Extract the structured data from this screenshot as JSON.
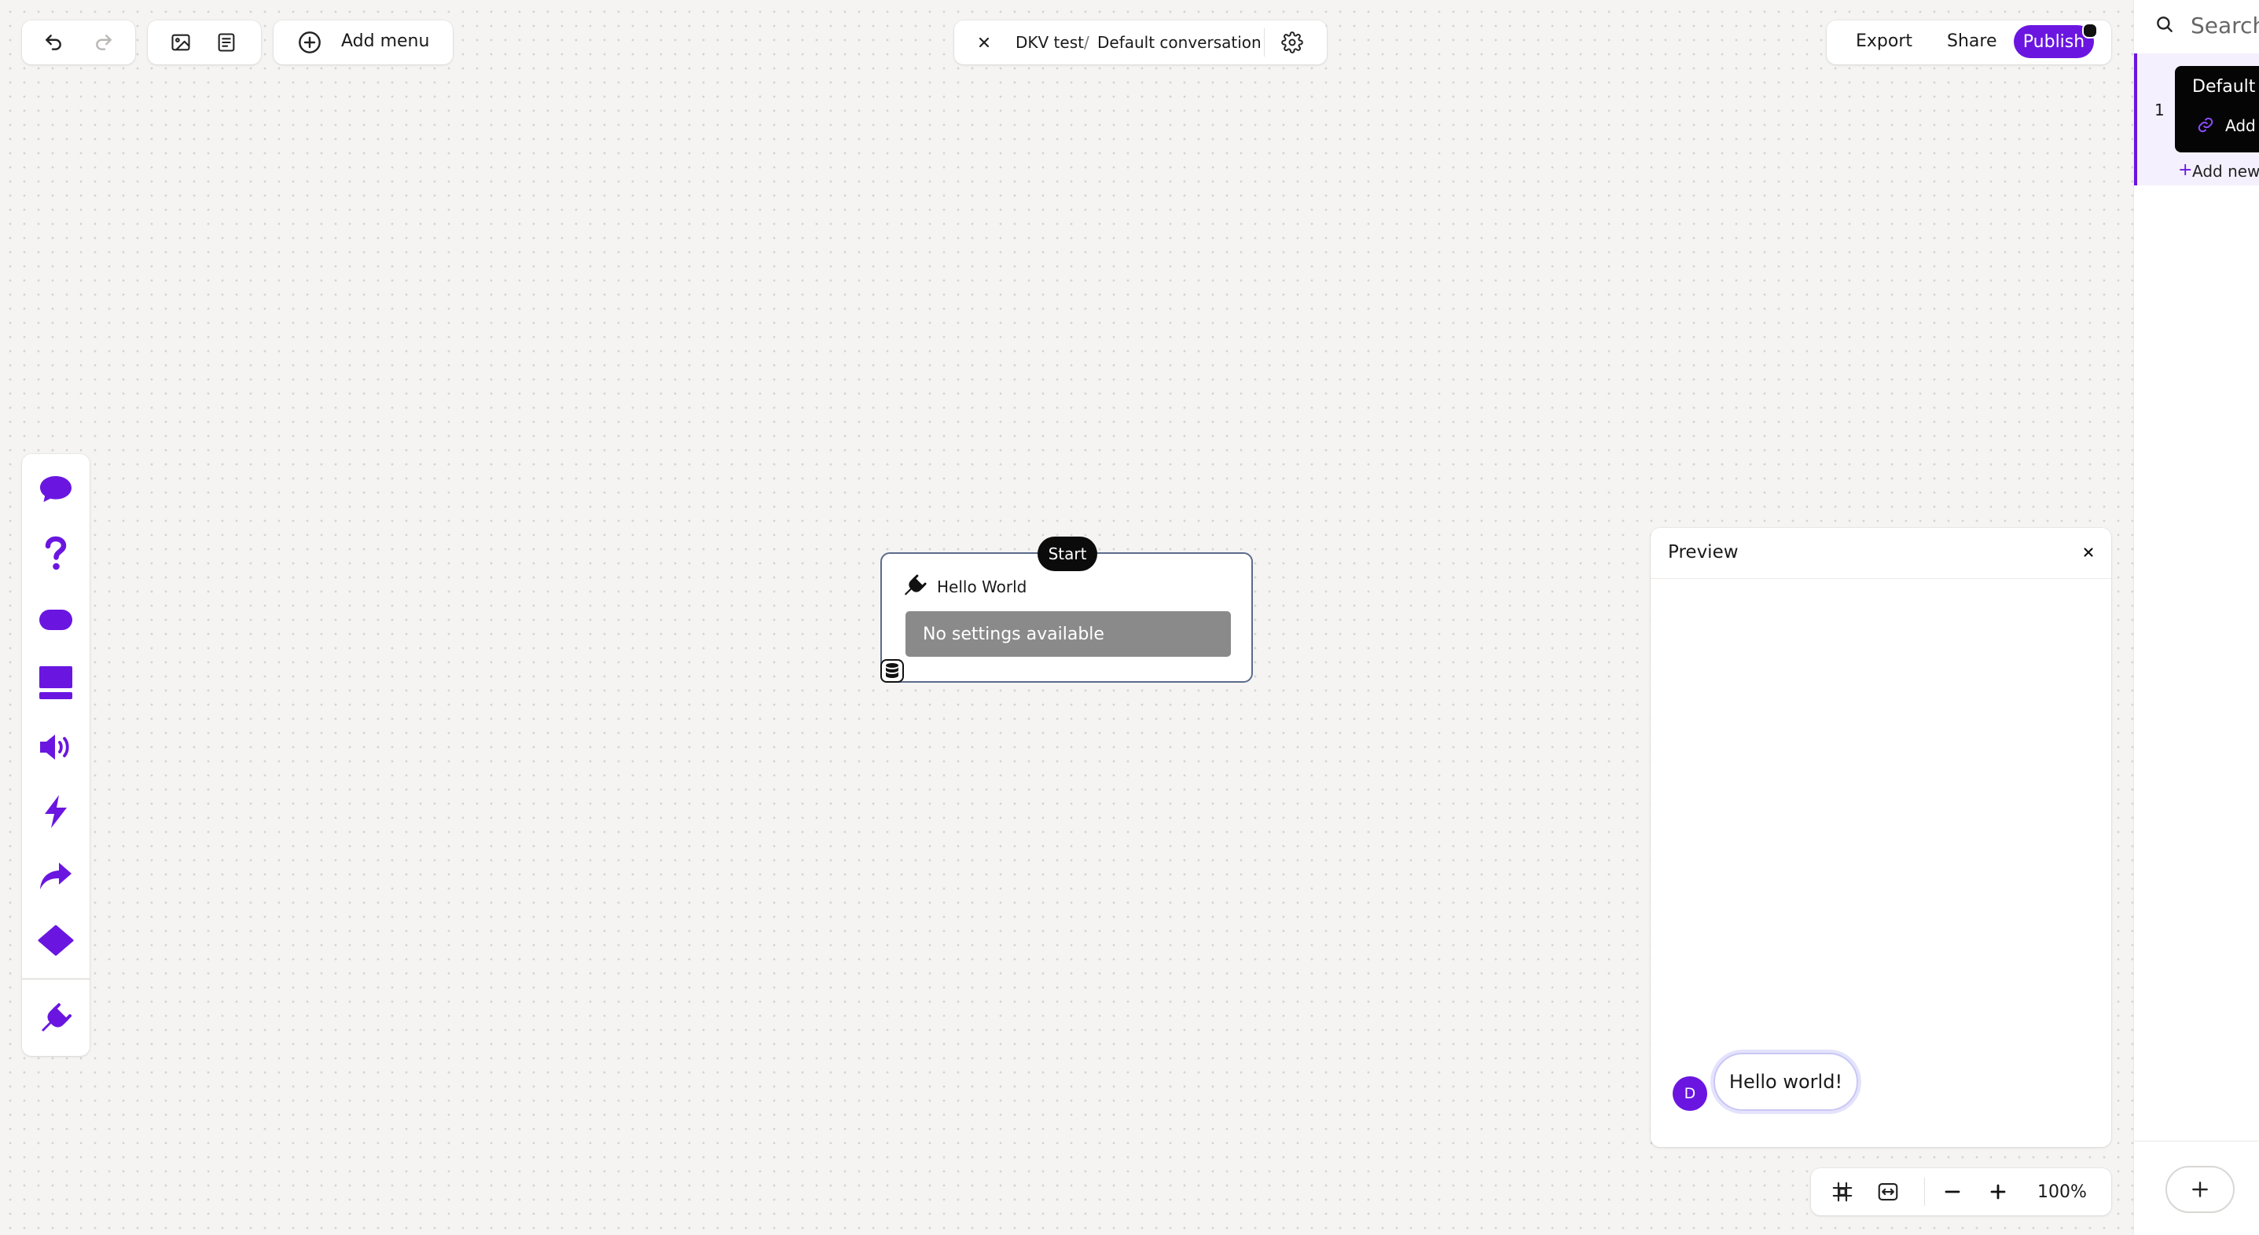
{
  "toolbar": {
    "undo_icon": "undo-icon",
    "redo_icon": "redo-icon",
    "image_icon": "image-icon",
    "text_icon": "document-icon",
    "add_menu_label": "Add menu"
  },
  "breadcrumb": {
    "project": "DKV test",
    "separator": "/",
    "conversation": "Default conversation"
  },
  "actions": {
    "export_label": "Export",
    "share_label": "Share",
    "publish_label": "Publish"
  },
  "left_tools": [
    {
      "icon": "chat-bubble-icon"
    },
    {
      "icon": "question-icon"
    },
    {
      "icon": "button-pill-icon"
    },
    {
      "icon": "carousel-icon"
    },
    {
      "icon": "speaker-icon"
    },
    {
      "icon": "lightning-icon"
    },
    {
      "icon": "redirect-arrow-icon"
    },
    {
      "icon": "diamond-icon"
    },
    {
      "icon": "plugin-icon"
    }
  ],
  "node": {
    "start_label": "Start",
    "title": "Hello World",
    "settings_text": "No settings available"
  },
  "preview": {
    "title": "Preview",
    "avatar_letter": "D",
    "message": "Hello world!"
  },
  "sidebar": {
    "search_placeholder": "Search",
    "item_number": "1",
    "item_title": "Default c",
    "item_sub": "Add",
    "add_new_label": "Add new"
  },
  "zoom": {
    "level": "100%"
  },
  "colors": {
    "accent": "#6a16e0",
    "canvas": "#f5f4f2"
  }
}
